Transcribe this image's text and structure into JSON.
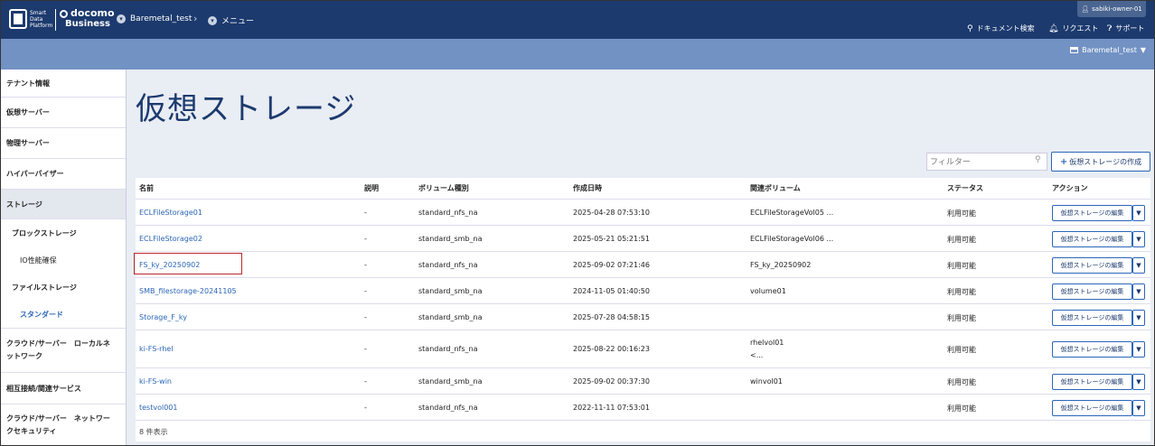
{
  "header": {
    "logo_sdp": [
      "Smart",
      "Data",
      "Platform"
    ],
    "logo_docomo_top": "docomo",
    "logo_docomo_bottom": "Business",
    "breadcrumb_tenant": "Baremetal_test",
    "breadcrumb_menu": "メニュー",
    "user": "sabiki-owner-01",
    "links": {
      "doc_search": "ドキュメント検索",
      "request": "リクエスト",
      "support": "サポート"
    },
    "tenant_selector": "Baremetal_test"
  },
  "sidebar": {
    "tenant_info": "テナント情報",
    "virtual_server": "仮想サーバー",
    "physical_server": "物理サーバー",
    "hypervisor": "ハイパーバイザー",
    "storage": "ストレージ",
    "block_storage": "ブロックストレージ",
    "io_reserve": "IO性能確保",
    "file_storage": "ファイルストレージ",
    "standard": "スタンダード",
    "cloud_local": [
      "クラウド/サーバー　ローカルネ",
      "ットワーク"
    ],
    "interconnect": "相互接続/関連サービス",
    "cloud_security": [
      "クラウド/サーバー　ネットワー",
      "クセキュリティ"
    ]
  },
  "main": {
    "title": "仮想ストレージ",
    "filter_placeholder": "フィルター",
    "create_button": "仮想ストレージの作成",
    "columns": [
      "名前",
      "説明",
      "ボリューム種別",
      "作成日時",
      "関連ボリューム",
      "ステータス",
      "アクション"
    ],
    "rows": [
      {
        "name": "ECLFileStorage01",
        "desc": "-",
        "type": "standard_nfs_na",
        "created": "2025-04-28 07:53:10",
        "volume": "ECLFileStorageVol05 ...",
        "volume2": "",
        "status": "利用可能"
      },
      {
        "name": "ECLFileStorage02",
        "desc": "-",
        "type": "standard_smb_na",
        "created": "2025-05-21 05:21:51",
        "volume": "ECLFileStorageVol06 ...",
        "volume2": "",
        "status": "利用可能"
      },
      {
        "name": "FS_ky_20250902",
        "desc": "-",
        "type": "standard_nfs_na",
        "created": "2025-09-02 07:21:46",
        "volume": "FS_ky_20250902",
        "volume2": "",
        "status": "利用可能"
      },
      {
        "name": "SMB_filestorage-20241105",
        "desc": "-",
        "type": "standard_smb_na",
        "created": "2024-11-05 01:40:50",
        "volume": "volume01",
        "volume2": "",
        "status": "利用可能"
      },
      {
        "name": "Storage_F_ky",
        "desc": "-",
        "type": "standard_smb_na",
        "created": "2025-07-28 04:58:15",
        "volume": "",
        "volume2": "",
        "status": "利用可能"
      },
      {
        "name": "ki-FS-rhel",
        "desc": "-",
        "type": "standard_nfs_na",
        "created": "2025-08-22 00:16:23",
        "volume": "rhelvol01",
        "volume2": "<...",
        "status": "利用可能"
      },
      {
        "name": "ki-FS-win",
        "desc": "-",
        "type": "standard_smb_na",
        "created": "2025-09-02 00:37:30",
        "volume": "winvol01",
        "volume2": "",
        "status": "利用可能"
      },
      {
        "name": "testvol001",
        "desc": "-",
        "type": "standard_nfs_na",
        "created": "2022-11-11 07:53:01",
        "volume": "",
        "volume2": "",
        "status": "利用可能"
      }
    ],
    "edit_button": "仮想ストレージの編集",
    "count": "8 件表示"
  },
  "colors": {
    "header": "#1c3a6e",
    "subbar": "#7292c4",
    "link": "#2b66b8",
    "highlight": "#c0272d"
  }
}
